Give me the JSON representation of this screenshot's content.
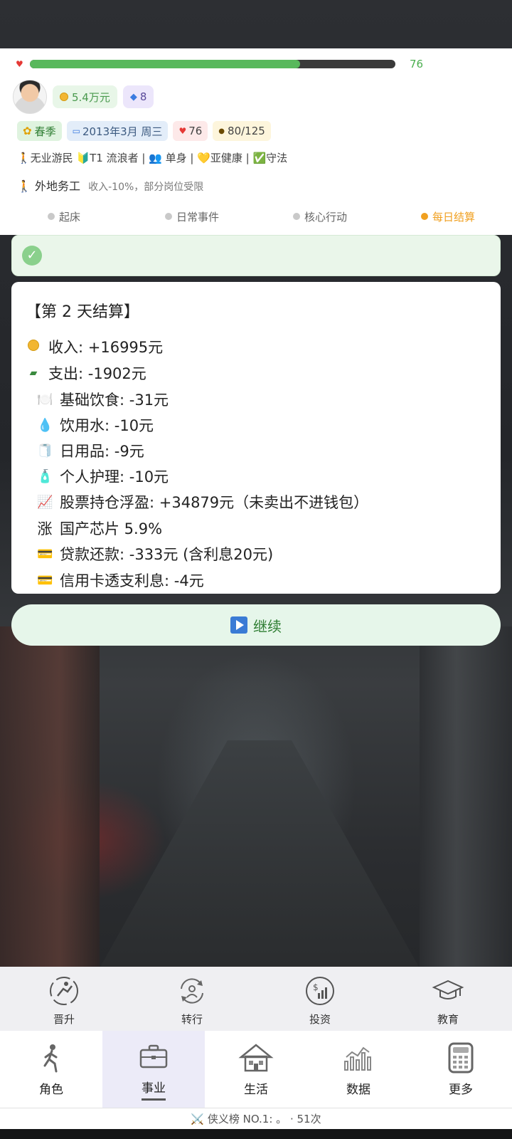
{
  "header": {
    "hp_percent": 0.74,
    "hp_value": "76",
    "money": "5.4万元",
    "gems": "8",
    "season": "春季",
    "date": "2013年3月 周三",
    "health": "76",
    "energy": "80/125",
    "status_line": "🚶无业游民 🔰T1 流浪者 | 👥 单身 | 💛亚健康 | ✅守法",
    "effect_title": "🚶 外地务工",
    "effect_desc": "收入-10%，部分岗位受限"
  },
  "steps": [
    "起床",
    "日常事件",
    "核心行动",
    "每日结算"
  ],
  "active_step": 3,
  "settlement": {
    "title": "【第 2 天结算】",
    "income": "收入: +16995元",
    "expense": "支出: -1902元",
    "items": [
      {
        "icon": "🍽️",
        "text": "基础饮食: -31元"
      },
      {
        "icon": "💧",
        "text": "饮用水: -10元"
      },
      {
        "icon": "🧻",
        "text": "日用品: -9元"
      },
      {
        "icon": "🧴",
        "text": "个人护理: -10元"
      },
      {
        "icon": "📈",
        "text": "股票持仓浮盈: +34879元（未卖出不进钱包）"
      },
      {
        "icon": "涨",
        "text": "国产芯片 5.9%"
      },
      {
        "icon": "💳",
        "text": "贷款还款: -333元 (含利息20元)"
      },
      {
        "icon": "💳",
        "text": "信用卡透支利息: -4元"
      }
    ]
  },
  "continue_label": "继续",
  "actions": [
    {
      "label": "晋升",
      "icon": "promotion-icon"
    },
    {
      "label": "转行",
      "icon": "career-change-icon"
    },
    {
      "label": "投资",
      "icon": "investment-icon"
    },
    {
      "label": "教育",
      "icon": "education-icon"
    }
  ],
  "nav": [
    {
      "label": "角色",
      "icon": "character-icon"
    },
    {
      "label": "事业",
      "icon": "briefcase-icon"
    },
    {
      "label": "生活",
      "icon": "house-icon"
    },
    {
      "label": "数据",
      "icon": "chart-icon"
    },
    {
      "label": "更多",
      "icon": "calculator-icon"
    }
  ],
  "active_nav": 1,
  "ticker": "⚔️ 侠义榜 NO.1: 。 · 51次"
}
